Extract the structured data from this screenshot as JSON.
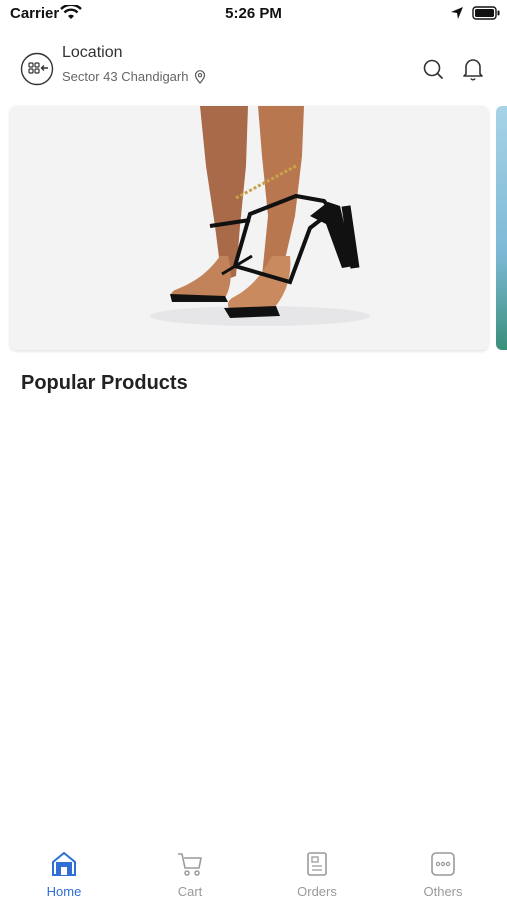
{
  "status_bar": {
    "carrier": "Carrier",
    "time": "5:26 PM"
  },
  "header": {
    "location_title": "Location",
    "location_value": "Sector 43 Chandigarh"
  },
  "section": {
    "title": "Popular Products"
  },
  "tabs": [
    {
      "label": "Home",
      "active": true
    },
    {
      "label": "Cart",
      "active": false
    },
    {
      "label": "Orders",
      "active": false
    },
    {
      "label": "Others",
      "active": false
    }
  ],
  "colors": {
    "accent": "#2f6fd6",
    "inactive": "#9a9a9a"
  }
}
